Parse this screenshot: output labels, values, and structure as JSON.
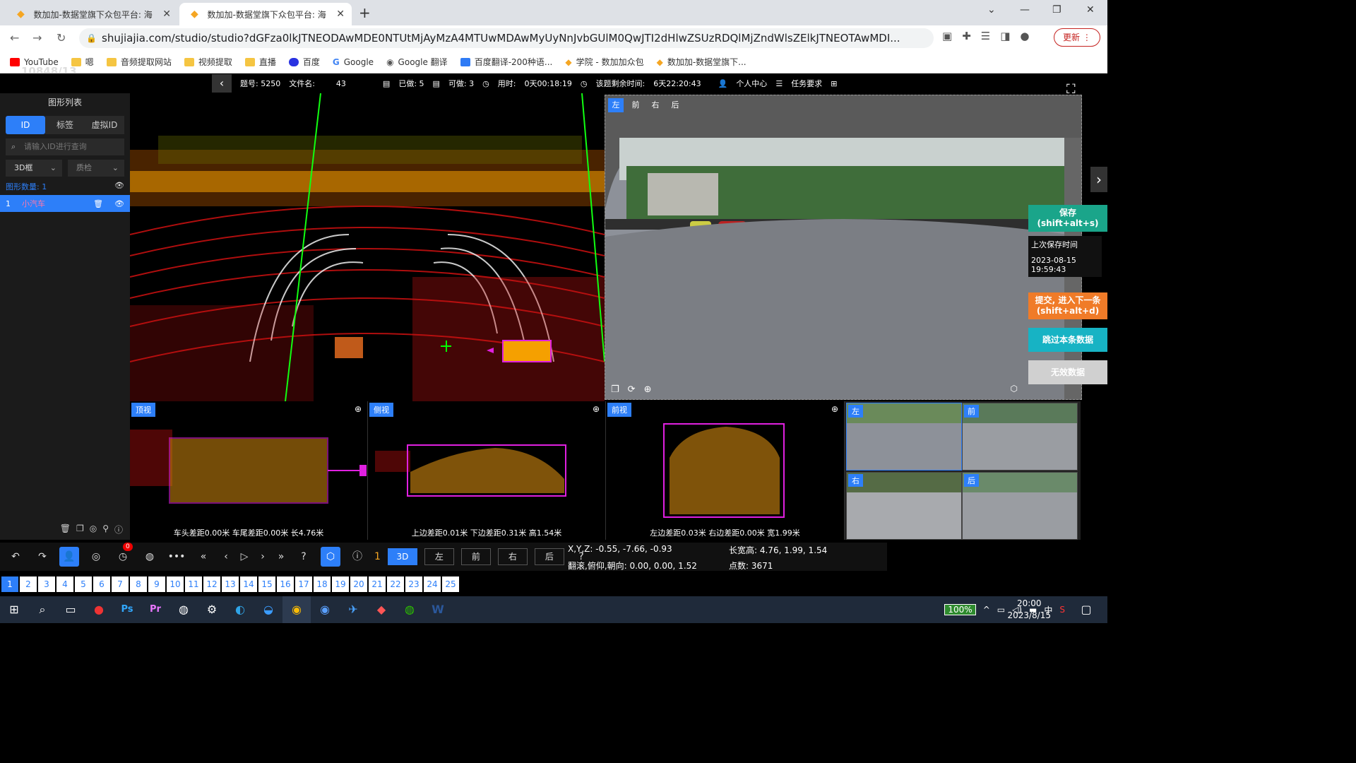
{
  "browser": {
    "tabs": [
      {
        "title": "数加加-数据堂旗下众包平台: 海",
        "active": false
      },
      {
        "title": "数加加-数据堂旗下众包平台: 海",
        "active": true
      }
    ],
    "url": "shujiajia.com/studio/studio?dGFza0lkJTNEODAwMDE0NTUtMjAyMzA4MTUwMDAwMyUyNnJvbGUlM0QwJTI2dHlwZSUzRDQlMjZndWlsZElkJTNEOTAwMDI...",
    "update_label": "更新",
    "bookmarks": [
      "YouTube",
      "嗯",
      "音频提取网站",
      "视频提取",
      "直播",
      "百度",
      "Google",
      "Google 翻译",
      "百度翻译-200种语...",
      "学院 - 数加加众包",
      "数加加-数据堂旗下..."
    ]
  },
  "overlay_counter": "10848/13",
  "topbar": {
    "item_no": "题号: 5250",
    "filename_label": "文件名:",
    "filename": "43",
    "done": "已做: 5",
    "available": "可做: 3",
    "time_label": "用时:",
    "time_value": "0天00:18:19",
    "remaining_label": "该题剩余时间:",
    "remaining_value": "6天22:20:43",
    "personal": "个人中心",
    "requirements": "任务要求"
  },
  "sidebar": {
    "title": "图形列表",
    "tabs": [
      "ID",
      "标签",
      "虚拟ID"
    ],
    "search_placeholder": "请输入ID进行查询",
    "select_type": "3D框",
    "select_qc": "质检",
    "count_label": "图形数量:",
    "count_value": "1",
    "rows": [
      {
        "id": "1",
        "name": "小汽车"
      }
    ]
  },
  "camera": {
    "tabs": [
      "左",
      "前",
      "右",
      "后"
    ]
  },
  "actions": {
    "save": "保存\n(shift+alt+s)",
    "last_save_label": "上次保存时间",
    "last_save_time": "2023-08-15 19:59:43",
    "submit": "提交, 进入下一条\n(shift+alt+d)",
    "skip": "跳过本条数据",
    "invalid": "无效数据"
  },
  "views": [
    {
      "label": "顶视",
      "info": "车头差距0.00米 车尾差距0.00米 长4.76米"
    },
    {
      "label": "侧视",
      "info": "上边差距0.01米 下边差距0.31米 高1.54米"
    },
    {
      "label": "前视",
      "info": "左边差距0.03米 右边差距0.00米 宽1.99米"
    }
  ],
  "thumbnails": [
    "左",
    "前",
    "右",
    "后"
  ],
  "toolbar": {
    "badge": "0",
    "frame_no": "1",
    "mode": "3D",
    "views": [
      "左",
      "前",
      "右",
      "后"
    ]
  },
  "coords": {
    "xyz": "X,Y,Z:  -0.55, -7.66, -0.93",
    "lwh": "长宽高:  4.76, 1.99, 1.54",
    "rot": "翻滚,俯仰,朝向:  0.00, 0.00, 1.52",
    "points": "点数:  3671"
  },
  "pages": [
    "1",
    "2",
    "3",
    "4",
    "5",
    "6",
    "7",
    "8",
    "9",
    "10",
    "11",
    "12",
    "13",
    "14",
    "15",
    "16",
    "17",
    "18",
    "19",
    "20",
    "21",
    "22",
    "23",
    "24",
    "25"
  ],
  "taskbar": {
    "battery": "100%",
    "ime": "中",
    "time": "20:00",
    "date": "2023/8/15"
  },
  "colors": {
    "accent": "#2d7ff9",
    "save": "#1aa58a",
    "submit": "#f07b28",
    "skip": "#17b3c4",
    "box": "#e020e0"
  }
}
